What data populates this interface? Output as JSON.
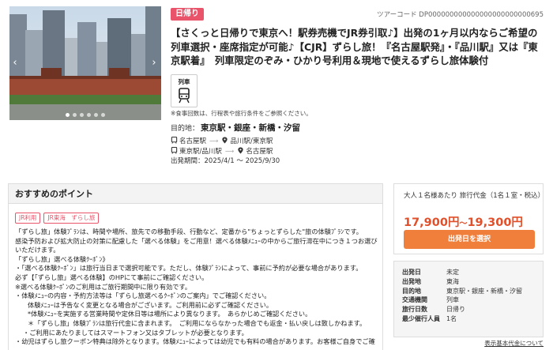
{
  "hero": {
    "prev_icon": "chevron-left-icon",
    "next_icon": "chevron-right-icon",
    "slide_count": 6,
    "active_slide": 1
  },
  "badge": "日帰り",
  "tour_code": "ツアーコード DP000000000000000000000000695",
  "title": "【さくっと日帰りで東京へ！駅券売機でJR券引取♪】出発の1ヶ月以内ならご希望の列車選択・座席指定が可能♪【CJR】ずらし旅！『名古屋駅発』・『品川駅』又は『東京駅着』　列車限定のぞみ・ひかり号利用＆現地で使えるずらし旅体験付",
  "transport": {
    "label": "列車",
    "icon": "train-icon"
  },
  "meal_note": "※食事回数は、行程表や旅行条件をご参照ください。",
  "destination": {
    "label": "目的地：",
    "value": "東京駅・銀座・新橋・汐留"
  },
  "routes": [
    {
      "from": "名古屋駅",
      "to": "品川駅/東京駅"
    },
    {
      "from": "東京駅/品川駅",
      "to": "名古屋駅"
    }
  ],
  "period": "出発期間：2025/4/1 ～ 2025/9/30",
  "recommend": {
    "heading": "おすすめのポイント",
    "tags": [
      "JR利用",
      "JR東海　ずらし旅"
    ],
    "lines": [
      "「ずらし旅」体験ﾌﾟﾗﾝは、時間や場所、旅先での移動手段、行動など、定番から\"ちょっとずらした\"旅の体験ﾌﾟﾗﾝです。",
      "感染予防および拡大防止の対策に配慮した「選べる体験」をご用意！選べる体験ﾒﾆｭｰの中からご旅行滞在中につき１つお選びいただけます。",
      "「ずらし旅」選べる体験ｸｰﾎﾟﾝ》",
      "・「選べる体験ｸｰﾎﾟﾝ」は旅行当日まで選択可能です。ただし、体験ﾌﾟﾗﾝによって、事前に予約が必要な場合があります。",
      "必ず【「ずらし旅」選べる体験】のHPにて事前にご確認ください。",
      "※選べる体験ｸｰﾎﾟﾝのご利用はご旅行期間中に限り有効です。",
      "・体験ﾒﾆｭｰの内容・予約方法等は「ずらし旅選べるｸｰﾎﾟﾝのご案内」でご確認ください。",
      "体験ﾒﾆｭｰは予告なく変更となる場合がございます。ご利用前に必ずご確認ください。",
      "*体験ﾒﾆｭｰを実施する営業時間や定休日等は場所により異なります。　あらかじめご確認ください。",
      "＊「ずらし旅」体験ﾌﾟﾗﾝは旅行代金に含まれます。　ご利用にならなかった場合でも返金・払い戻しは致しかねます。",
      "・ご利用にあたりましてはスマートフォン又はタブレットが必要となります。",
      "・幼児はずらし旅クーポン特典は除外となります。体験ﾒﾆｭｰによっては幼児でも有料の場合があります。お客様ご自身でご確"
    ]
  },
  "price": {
    "label": "大人１名様あたり 旅行代金（1名１室・税込）",
    "min": "17,900円",
    "max": "19,300円",
    "separator": "～",
    "button": "出発日を選択"
  },
  "info": [
    {
      "key": "出発日",
      "value": "未定"
    },
    {
      "key": "出発地",
      "value": "東海"
    },
    {
      "key": "目的地",
      "value": "東京駅・銀座・新橋・汐留"
    },
    {
      "key": "交通機関",
      "value": "列車"
    },
    {
      "key": "旅行日数",
      "value": "日帰り"
    },
    {
      "key": "最少催行人員",
      "value": "1名"
    }
  ],
  "table_link": "表示基本代金について",
  "colors": {
    "accent": "#e9546b",
    "price": "#e0502b",
    "button": "#f07f3c"
  }
}
